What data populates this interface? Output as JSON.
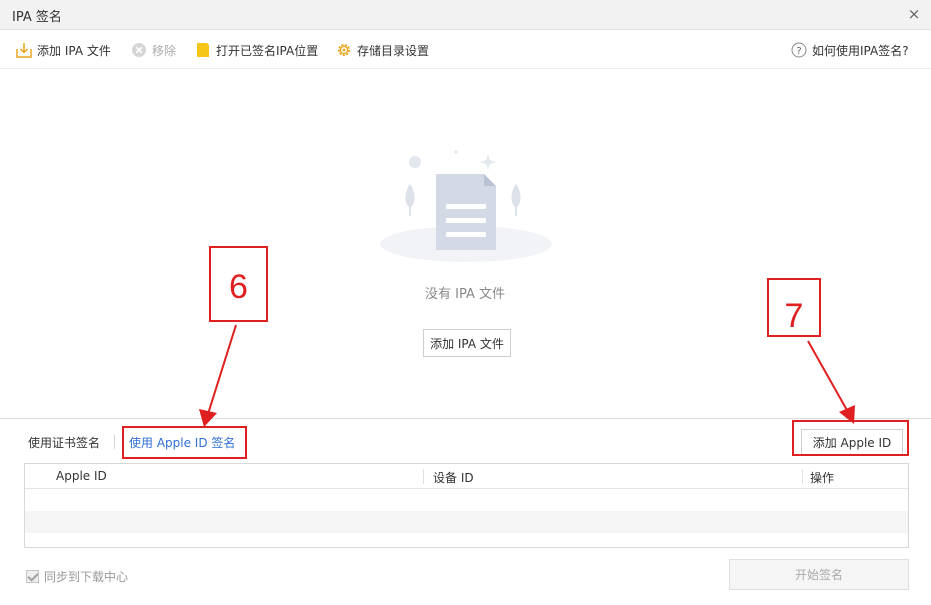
{
  "window": {
    "title": "IPA 签名",
    "close_glyph": "×"
  },
  "toolbar": {
    "add_ipa": "添加 IPA 文件",
    "remove": "移除",
    "open_signed": "打开已签名IPA位置",
    "storage": "存储目录设置",
    "help": "如何使用IPA签名?"
  },
  "empty_state": {
    "message": "没有 IPA 文件",
    "add_button": "添加 IPA 文件"
  },
  "tabs": {
    "cert": "使用证书签名",
    "apple_id": "使用 Apple ID 签名"
  },
  "add_apple_id_button": "添加 Apple ID",
  "table": {
    "columns": [
      "Apple ID",
      "设备 ID",
      "操作"
    ]
  },
  "sync": {
    "label": "同步到下载中心",
    "checked": true
  },
  "start_button": "开始签名",
  "annotations": {
    "box6": "6",
    "box7": "7"
  },
  "colors": {
    "accent": "#2f6fd6",
    "annotation": "#e02020",
    "folder": "#f5c518"
  }
}
